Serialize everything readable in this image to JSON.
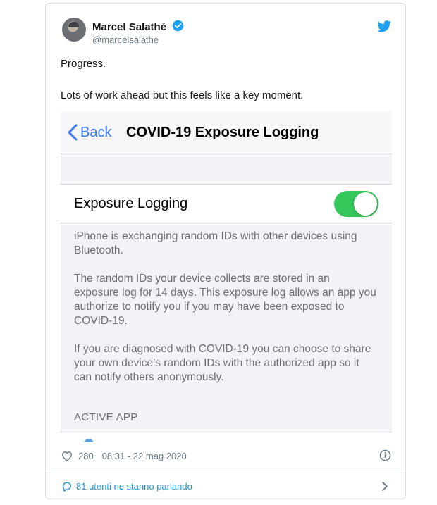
{
  "tweet": {
    "author_name": "Marcel Salathé",
    "handle": "@marcelsalathe",
    "line1": "Progress.",
    "line2": "Lots of work ahead but this feels like a key moment."
  },
  "screenshot": {
    "back_label": "Back",
    "nav_title": "COVID-19 Exposure Logging",
    "setting_label": "Exposure Logging",
    "toggle_on": true,
    "paragraph1": "iPhone is exchanging random IDs with other devices using Bluetooth.",
    "paragraph2": "The random IDs your device collects are stored in an exposure log for 14 days. This exposure log allows an app you authorize to notify you if you may have been exposed to COVID-19.",
    "paragraph3": "If you are diagnosed with COVID-19 you can choose to share your own device’s random IDs with the authorized app so it can notify others anonymously.",
    "section_header": "ACTIVE APP"
  },
  "footer": {
    "likes": "280",
    "timestamp": "08:31 - 22 mag 2020",
    "talking": "81 utenti ne stanno parlando"
  },
  "colors": {
    "twitter_blue": "#1b95e0",
    "ios_blue": "#3478f6",
    "toggle_green": "#34c759"
  },
  "icons": [
    "verified-badge-icon",
    "twitter-bird-icon",
    "back-chevron-icon",
    "heart-icon",
    "info-icon",
    "comment-icon",
    "chevron-right-icon"
  ]
}
